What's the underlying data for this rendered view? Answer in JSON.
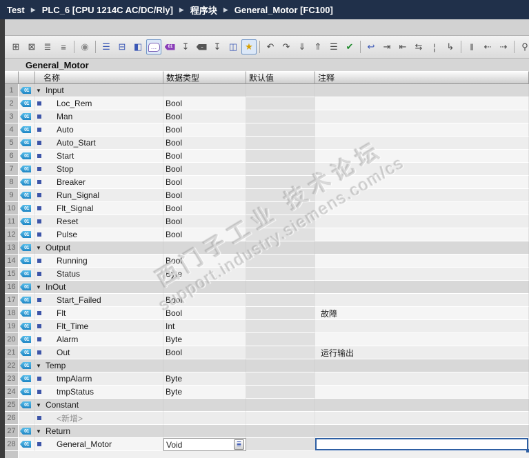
{
  "breadcrumb": {
    "separator": "▶",
    "items": [
      "Test",
      "PLC_6 [CPU 1214C AC/DC/Rly]",
      "程序块",
      "General_Motor [FC100]"
    ]
  },
  "toolbar": {
    "icons": [
      {
        "name": "insert-row-icon",
        "glyph": "⊞"
      },
      {
        "name": "delete-row-icon",
        "glyph": "⊠"
      },
      {
        "name": "add-row-icon",
        "glyph": "≣"
      },
      {
        "name": "add-row-below-icon",
        "glyph": "≡"
      },
      {
        "sep": true
      },
      {
        "name": "keep-actual-values-icon",
        "glyph": "◉",
        "color": "#8a8a8a"
      },
      {
        "sep": true
      },
      {
        "name": "expand-all-networks-icon",
        "glyph": "☰",
        "color": "#3a57b5"
      },
      {
        "name": "editor-split-icon",
        "glyph": "⊟",
        "color": "#3a57b5"
      },
      {
        "name": "network-list-icon",
        "glyph": "◧",
        "color": "#3a57b5"
      },
      {
        "name": "comments-toggle-icon",
        "kind": "bubble",
        "glyph": "…",
        "active": true
      },
      {
        "name": "interface-tags-icon",
        "kind": "tag",
        "glyph": "01",
        "color": "#8a3db8"
      },
      {
        "name": "expand-members-icon",
        "glyph": "↧"
      },
      {
        "name": "snapshot-values-icon",
        "kind": "tag",
        "glyph": "..",
        "color": "#555555"
      },
      {
        "name": "collapse-members-icon",
        "glyph": "↧"
      },
      {
        "name": "window-layout-icon",
        "glyph": "◫",
        "color": "#3a57b5"
      },
      {
        "name": "favorites-toggle-icon",
        "glyph": "★",
        "color": "#d79f00",
        "active": true
      },
      {
        "sep": true
      },
      {
        "name": "undo-icon",
        "glyph": "↶"
      },
      {
        "name": "redo-icon",
        "glyph": "↷"
      },
      {
        "name": "load-snapshot-icon",
        "glyph": "⇓"
      },
      {
        "name": "save-snapshot-icon",
        "glyph": "⇑"
      },
      {
        "name": "sort-lines-icon",
        "glyph": "☰"
      },
      {
        "name": "compile-icon",
        "glyph": "✔",
        "color": "#1d8a2a"
      },
      {
        "sep": true
      },
      {
        "name": "go-to-definition-icon",
        "glyph": "↩",
        "color": "#3a57b5"
      },
      {
        "name": "forward-reference-icon",
        "glyph": "⇥"
      },
      {
        "name": "backward-reference-icon",
        "glyph": "⇤"
      },
      {
        "name": "update-references-icon",
        "glyph": "⇆"
      },
      {
        "name": "absolute-operands-icon",
        "glyph": "¦"
      },
      {
        "name": "branch-icon",
        "glyph": "↳"
      },
      {
        "sep": true
      },
      {
        "name": "bookmarks-icon",
        "glyph": "‖"
      },
      {
        "name": "previous-bookmark-icon",
        "glyph": "⇠"
      },
      {
        "name": "next-bookmark-icon",
        "glyph": "⇢"
      },
      {
        "sep": true
      },
      {
        "name": "find-replace-icon",
        "glyph": "⚲"
      },
      {
        "name": "operand-display-icon",
        "glyph": "▣",
        "color": "#2a8fb0"
      }
    ]
  },
  "editor": {
    "title": "General_Motor"
  },
  "table": {
    "columns": {
      "name": "名称",
      "type": "数据类型",
      "default": "默认值",
      "comment": "注释"
    },
    "rows": [
      {
        "num": "1",
        "kind": "section",
        "name": "Input"
      },
      {
        "num": "2",
        "kind": "member",
        "name": "Loc_Rem",
        "type": "Bool"
      },
      {
        "num": "3",
        "kind": "member",
        "name": "Man",
        "type": "Bool"
      },
      {
        "num": "4",
        "kind": "member",
        "name": "Auto",
        "type": "Bool"
      },
      {
        "num": "5",
        "kind": "member",
        "name": "Auto_Start",
        "type": "Bool"
      },
      {
        "num": "6",
        "kind": "member",
        "name": "Start",
        "type": "Bool"
      },
      {
        "num": "7",
        "kind": "member",
        "name": "Stop",
        "type": "Bool"
      },
      {
        "num": "8",
        "kind": "member",
        "name": "Breaker",
        "type": "Bool"
      },
      {
        "num": "9",
        "kind": "member",
        "name": "Run_Signal",
        "type": "Bool"
      },
      {
        "num": "10",
        "kind": "member",
        "name": "Flt_Signal",
        "type": "Bool"
      },
      {
        "num": "11",
        "kind": "member",
        "name": "Reset",
        "type": "Bool"
      },
      {
        "num": "12",
        "kind": "member",
        "name": "Pulse",
        "type": "Bool"
      },
      {
        "num": "13",
        "kind": "section",
        "name": "Output"
      },
      {
        "num": "14",
        "kind": "member",
        "name": "Running",
        "type": "Bool"
      },
      {
        "num": "15",
        "kind": "member",
        "name": "Status",
        "type": "Byte"
      },
      {
        "num": "16",
        "kind": "section",
        "name": "InOut"
      },
      {
        "num": "17",
        "kind": "member",
        "name": "Start_Failed",
        "type": "Bool"
      },
      {
        "num": "18",
        "kind": "member",
        "name": "Flt",
        "type": "Bool",
        "comment": "故障"
      },
      {
        "num": "19",
        "kind": "member",
        "name": "Flt_Time",
        "type": "Int"
      },
      {
        "num": "20",
        "kind": "member",
        "name": "Alarm",
        "type": "Byte"
      },
      {
        "num": "21",
        "kind": "member",
        "name": "Out",
        "type": "Bool",
        "comment": "运行输出"
      },
      {
        "num": "22",
        "kind": "section",
        "name": "Temp"
      },
      {
        "num": "23",
        "kind": "member",
        "name": "tmpAlarm",
        "type": "Byte"
      },
      {
        "num": "24",
        "kind": "member",
        "name": "tmpStatus",
        "type": "Byte"
      },
      {
        "num": "25",
        "kind": "section",
        "name": "Constant"
      },
      {
        "num": "26",
        "kind": "addnew",
        "name": "<新增>"
      },
      {
        "num": "27",
        "kind": "section",
        "name": "Return"
      },
      {
        "num": "28",
        "kind": "member",
        "name": "General_Motor",
        "type": "Void",
        "type_button": true,
        "comment_editing": true,
        "comment": ""
      }
    ]
  },
  "ui": {
    "tag_label": "01",
    "section_arrow": "▼",
    "dropdown_list_glyph": "≣"
  },
  "watermark": {
    "line1": "西门子工业  技术论坛",
    "line2": "support.industry.siemens.com/cs"
  }
}
